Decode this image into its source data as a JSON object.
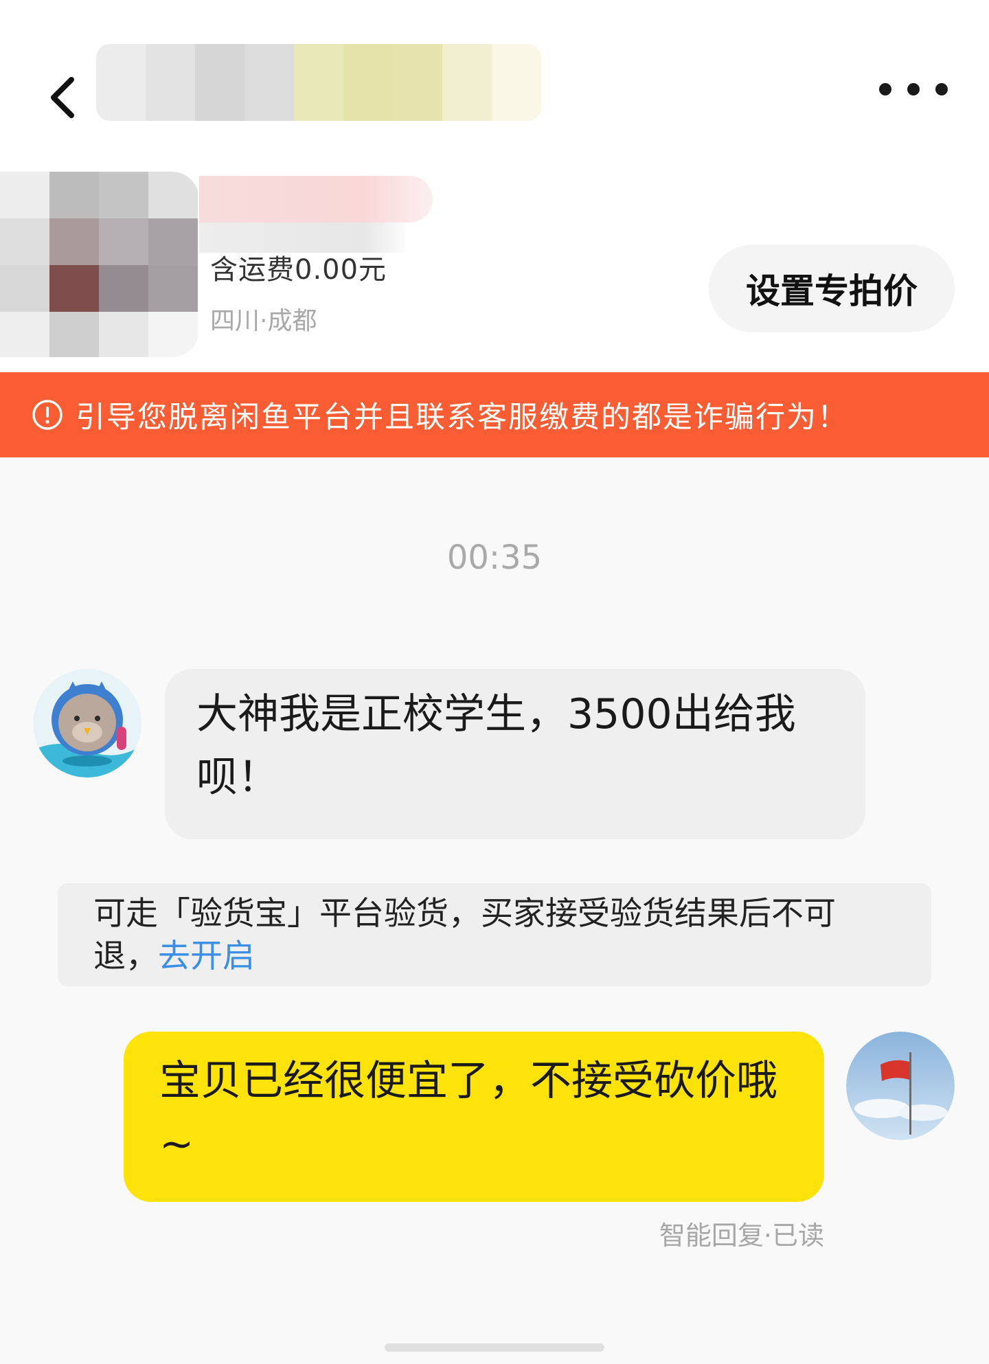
{
  "header": {
    "shipping_text": "含运费0.00元",
    "location_text": "四川·成都",
    "special_price_label": "设置专拍价"
  },
  "warning": {
    "text": "引导您脱离闲鱼平台并且联系客服缴费的都是诈骗行为！"
  },
  "chat": {
    "timestamp": "00:35",
    "messages": [
      {
        "sender": "buyer",
        "text": "大神我是正校学生，3500出给我呗！",
        "avatar_icon": "cartoon-seal-avatar-icon"
      },
      {
        "sender": "seller",
        "text": "宝贝已经很便宜了，不接受砍价哦~",
        "avatar_icon": "flag-sky-avatar-icon"
      }
    ],
    "system_notice": {
      "text": "可走「验货宝」平台验货，买家接受验货结果后不可退，",
      "link_text": "去开启"
    },
    "reply_status": "智能回复·已读"
  },
  "colors": {
    "warning_bg": "#fa5d33",
    "seller_bubble": "#fee30b",
    "buyer_bubble": "#efefef",
    "link": "#3a8ee6"
  }
}
